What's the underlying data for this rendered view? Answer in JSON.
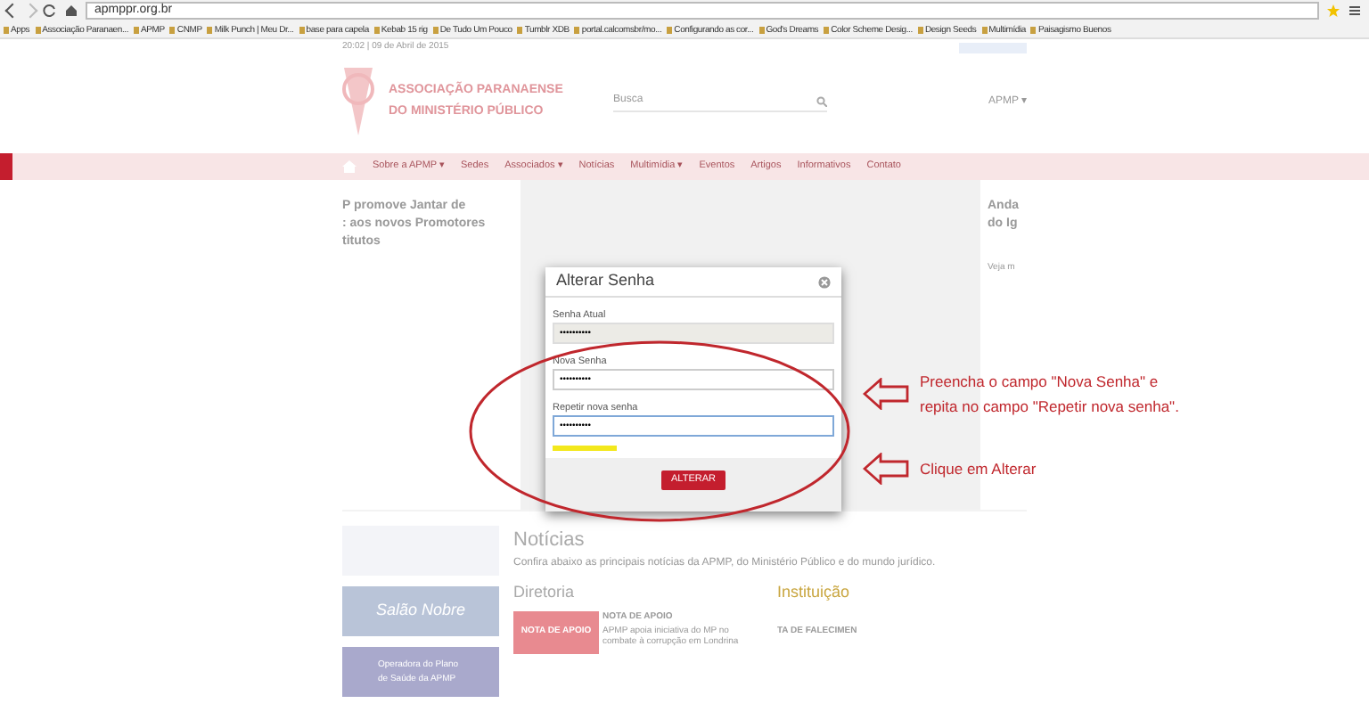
{
  "browser": {
    "url": "apmppr.org.br",
    "bookmarks": [
      "Apps",
      "Associação Paranaen...",
      "APMP",
      "CNMP",
      "Milk Punch | Meu Dr...",
      "base para capela",
      "Kebab 15 rig",
      "De Tudo Um Pouco",
      "Tumblr XDB",
      "portal.calcomsbr/mo...",
      "Configurando as cor...",
      "God's Dreams",
      "Color Scheme Desig...",
      "Design Seeds",
      "Multimídia",
      "Paisagismo Buenos"
    ]
  },
  "site": {
    "date": "20:02 | 09 de Abril de 2015",
    "logo_lines": [
      "ASSOCIAÇÃO PARANAENSE",
      "DO MINISTÉRIO PÚBLICO"
    ],
    "search": {
      "placeholder": "Busca"
    },
    "account": "APMP ▾",
    "nav": [
      "Sobre a APMP ▾",
      "Sedes",
      "Associados ▾",
      "Notícias",
      "Multimídia ▾",
      "Eventos",
      "Artigos",
      "Informativos",
      "Contato"
    ],
    "left_headline": [
      "P promove Jantar de",
      ": aos novos Promotores",
      "titutos"
    ],
    "right_headline": [
      "Anda",
      "do Ig"
    ],
    "right_link": "Veja m",
    "news_title": "Notícias",
    "news_intro": "Confira abaixo as principais notícias da APMP, do Ministério Público e do mundo jurídico.",
    "sections": [
      "Diretoria",
      "Instituição"
    ],
    "note": {
      "banner": "NOTA DE APOIO",
      "title": "NOTA DE APOIO",
      "text": "APMP apoia iniciativa do MP no combate à corrupção em Londrina"
    },
    "side_item": "TA DE FALECIMEN",
    "side_banners": [
      "Salão Nobre",
      "Operadora do Plano de Saúde da APMP"
    ]
  },
  "modal": {
    "title": "Alterar Senha",
    "fields": [
      {
        "label": "Senha Atual",
        "value": "••••••••••",
        "disabled": true,
        "focused": false
      },
      {
        "label": "Nova Senha",
        "value": "••••••••••",
        "disabled": false,
        "focused": false
      },
      {
        "label": "Repetir nova senha",
        "value": "••••••••••",
        "disabled": false,
        "focused": true
      }
    ],
    "strength": {
      "level": 0.23
    },
    "button": "ALTERAR"
  },
  "annotations": [
    {
      "lines": [
        "Preencha o campo \"Nova Senha\" e",
        "repita no campo \"Repetir nova senha\"."
      ]
    },
    {
      "lines": [
        "Clique em Alterar"
      ]
    }
  ]
}
